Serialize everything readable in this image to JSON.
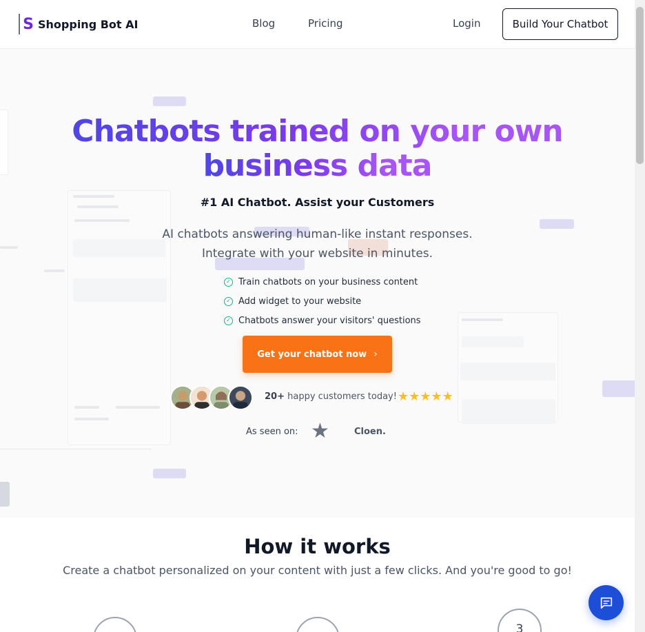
{
  "header": {
    "logo_letter": "S",
    "brand": "Shopping Bot AI",
    "nav": {
      "blog": "Blog",
      "pricing": "Pricing",
      "login": "Login"
    },
    "cta": "Build Your Chatbot"
  },
  "hero": {
    "title_line1": "Chatbots trained on your own",
    "title_line2": "business data",
    "subtitle": "#1 AI Chatbot. Assist your Customers",
    "description_line1": "AI chatbots answering human-like instant responses.",
    "description_line2": "Integrate with your website in minutes.",
    "features": [
      "Train chatbots on your business content",
      "Add widget to your website",
      "Chatbots answer your visitors' questions"
    ],
    "cta": "Get your chatbot now",
    "customers_count": "20+",
    "customers_text": "happy customers today!",
    "rating_stars": 5,
    "seen_on_label": "As seen on:",
    "seen_on_brand": "Cloen."
  },
  "how_it_works": {
    "title": "How it works",
    "description": "Create a chatbot personalized on your content with just a few clicks. And you're good to go!",
    "steps": [
      "",
      "",
      "3"
    ]
  },
  "colors": {
    "accent": "#f97316",
    "gradient_start": "#4f46e5",
    "gradient_end": "#a855f7",
    "check": "#10b981",
    "chat_widget": "#1d4ed8",
    "star": "#fbbf24"
  },
  "icons": [
    "check-circle-icon",
    "chevron-right-icon",
    "star-icon",
    "chat-icon"
  ]
}
